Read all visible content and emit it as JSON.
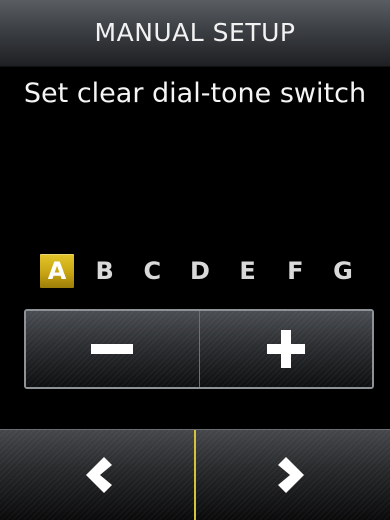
{
  "header": {
    "title": "MANUAL SETUP"
  },
  "instruction": "Set clear dial-tone switch",
  "letters": {
    "selected": "A",
    "items": [
      "A",
      "B",
      "C",
      "D",
      "E",
      "F",
      "G"
    ]
  },
  "stepper": {
    "decrement_icon": "minus-icon",
    "increment_icon": "plus-icon"
  },
  "nav": {
    "back_icon": "chevron-left-icon",
    "next_icon": "chevron-right-icon"
  },
  "colors": {
    "accent": "#d4b21e",
    "background": "#000000",
    "text": "#ffffff"
  }
}
